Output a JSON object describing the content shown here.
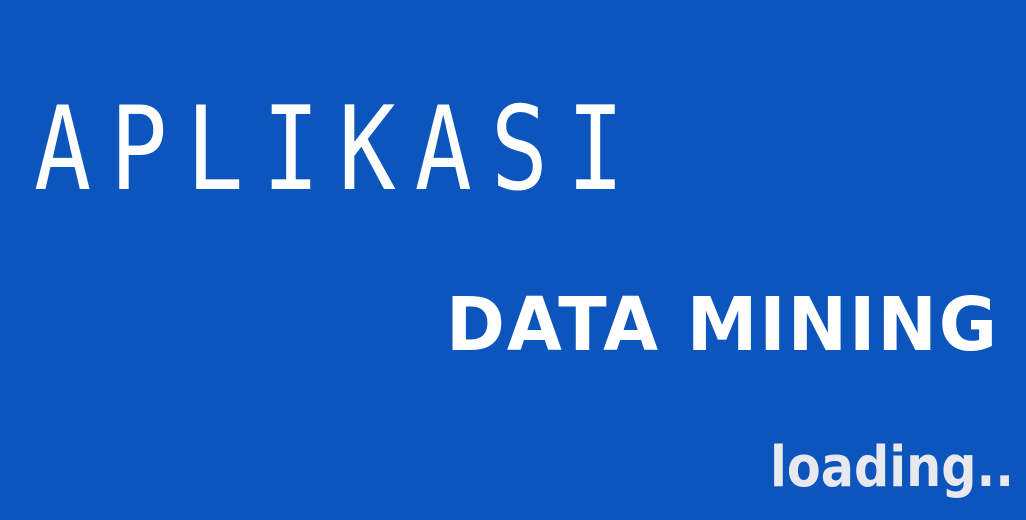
{
  "splash": {
    "title": "APLIKASI",
    "subtitle": "DATA MINING",
    "status": "loading.."
  },
  "colors": {
    "background": "#0b55bc",
    "text": "#ffffff",
    "status_text": "#e8e8ee"
  }
}
